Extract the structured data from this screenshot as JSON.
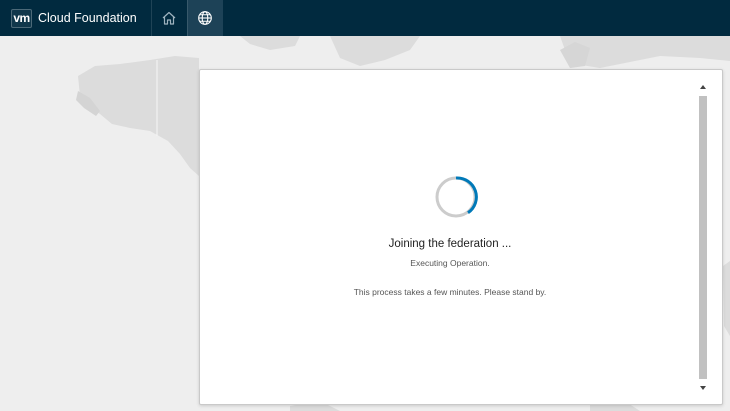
{
  "header": {
    "brand_logo": "vm",
    "brand_title": "Cloud Foundation",
    "nav": [
      {
        "icon": "home-icon",
        "active": false
      },
      {
        "icon": "globe-icon",
        "active": true
      }
    ]
  },
  "dialog": {
    "title": "Joining the federation ...",
    "subtitle": "Executing Operation.",
    "note": "This process takes a few minutes. Please stand by."
  },
  "colors": {
    "header_bg": "#012a3f",
    "active_nav_bg": "#1d4257",
    "spinner_accent": "#0079b8",
    "spinner_track": "#cccccc",
    "map_land": "#dcdcdc",
    "map_water": "#eeeeee"
  }
}
